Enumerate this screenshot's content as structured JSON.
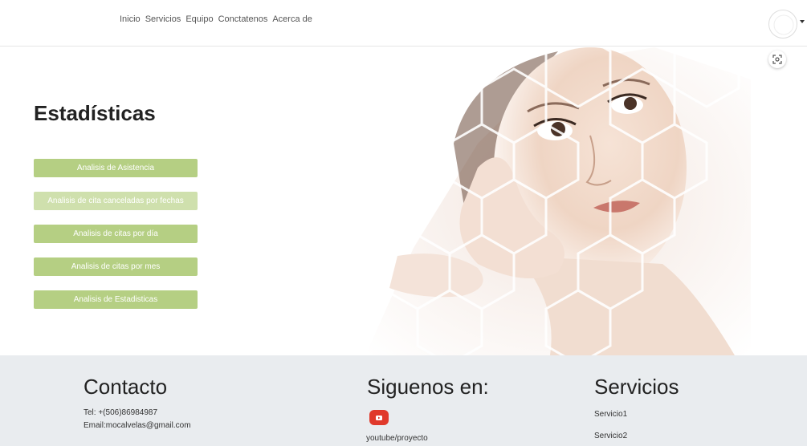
{
  "nav": {
    "links": [
      "Inicio",
      "Servicios",
      "Equipo",
      "Conctatenos",
      "Acerca de"
    ]
  },
  "icons": {
    "avatar": "avatar-icon",
    "scan": "scan-icon",
    "youtube": "youtube-icon"
  },
  "stats": {
    "title": "Estadísticas",
    "buttons": [
      "Analisis de Asistencia",
      "Analisis de cita canceladas por fechas",
      "Analisis de citas por día",
      "Analisis de citas por mes",
      "Analisis de Estadisticas"
    ]
  },
  "footer": {
    "contact_title": "Contacto",
    "tel": "Tel: +(506)86984987",
    "email": "Email:mocalvelas@gmail.com",
    "follow_title": "Siguenos en:",
    "youtube": "youtube/proyecto",
    "services_title": "Servicios",
    "services": [
      "Servicio1",
      "Servicio2"
    ]
  },
  "colors": {
    "button": "#b5cf83",
    "button_light": "#cfe0ad",
    "footer_bg": "#e9ecef",
    "youtube": "#e0392b"
  }
}
